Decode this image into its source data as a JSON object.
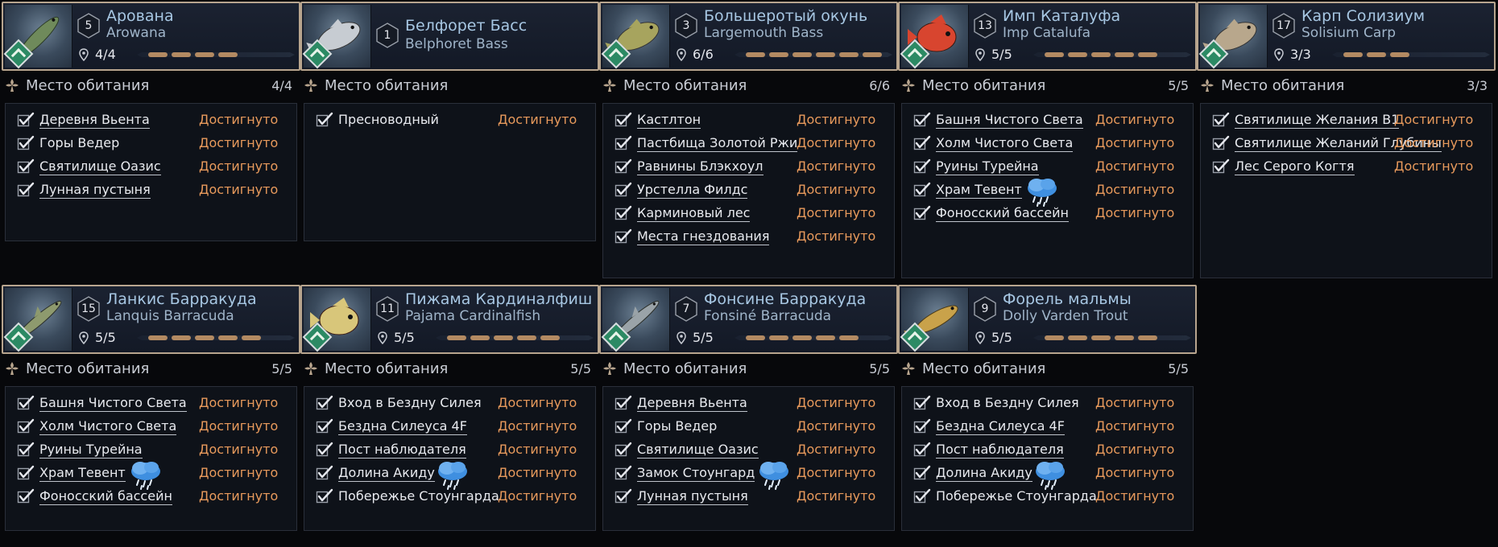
{
  "section_title": "Место обитания",
  "status_label": "Достигнуто",
  "colors": {
    "frame": "#b8a58e",
    "status": "#e89a5c",
    "name": "#a7c7e3",
    "progress": "#b38a62",
    "habitat": "#2c8a64"
  },
  "cards": [
    {
      "id": "arowana",
      "level": "5",
      "name_ru": "Арована",
      "name_en": "Arowana",
      "count": "4/4",
      "progress_segments": 4,
      "fish": "arowana",
      "fish_color": "#6f8a5b",
      "habitat_count": "4/4",
      "locations": [
        {
          "name": "Деревня Вьента",
          "link": true,
          "rain": false
        },
        {
          "name": "Горы Ведер",
          "link": false,
          "rain": false
        },
        {
          "name": "Святилище Оазис",
          "link": true,
          "rain": false
        },
        {
          "name": "Лунная пустыня",
          "link": true,
          "rain": false
        }
      ]
    },
    {
      "id": "belphoret-bass",
      "level": "1",
      "name_ru": "Белфорет Басс",
      "name_en": "Belphoret Bass",
      "count": "",
      "progress_segments": 0,
      "fish": "bass",
      "fish_color": "#c7ccd2",
      "habitat_count": "",
      "locations": [
        {
          "name": "Пресноводный",
          "link": false,
          "rain": false
        }
      ]
    },
    {
      "id": "largemouth-bass",
      "level": "3",
      "name_ru": "Большеротый окунь",
      "name_en": "Largemouth Bass",
      "count": "6/6",
      "progress_segments": 6,
      "fish": "bass",
      "fish_color": "#a7a45e",
      "habitat_count": "6/6",
      "locations": [
        {
          "name": "Кастлтон",
          "link": true,
          "rain": false
        },
        {
          "name": "Пастбища Золотой Ржи",
          "link": true,
          "rain": false
        },
        {
          "name": "Равнины Блэкхоул",
          "link": true,
          "rain": false
        },
        {
          "name": "Урстелла Филдс",
          "link": true,
          "rain": false
        },
        {
          "name": "Карминовый лес",
          "link": true,
          "rain": false
        },
        {
          "name": "Места гнездования",
          "link": true,
          "rain": false
        }
      ]
    },
    {
      "id": "imp-catalufa",
      "level": "13",
      "name_ru": "Имп Каталуфа",
      "name_en": "Imp Catalufa",
      "count": "5/5",
      "progress_segments": 5,
      "fish": "round",
      "fish_color": "#d8452f",
      "habitat_count": "5/5",
      "locations": [
        {
          "name": "Башня Чистого Света",
          "link": true,
          "rain": false
        },
        {
          "name": "Холм Чистого Света",
          "link": true,
          "rain": false
        },
        {
          "name": "Руины Турейна",
          "link": true,
          "rain": false
        },
        {
          "name": "Храм Тевент",
          "link": true,
          "rain": true
        },
        {
          "name": "Фоносский бассейн",
          "link": true,
          "rain": false
        }
      ]
    },
    {
      "id": "solisium-carp",
      "level": "17",
      "name_ru": "Карп Солизиум",
      "name_en": "Solisium Carp",
      "count": "3/3",
      "progress_segments": 3,
      "fish": "bass",
      "fish_color": "#b8a78c",
      "habitat_count": "3/3",
      "locations": [
        {
          "name": "Святилище Желания B1",
          "link": true,
          "rain": false
        },
        {
          "name": "Святилище Желаний Глубины",
          "link": true,
          "rain": false
        },
        {
          "name": "Лес Серого Когтя",
          "link": true,
          "rain": false
        }
      ]
    },
    {
      "id": "lanquis-barracuda",
      "level": "15",
      "name_ru": "Ланкис Барракуда",
      "name_en": "Lanquis Barracuda",
      "count": "5/5",
      "progress_segments": 5,
      "fish": "long",
      "fish_color": "#8e9a6e",
      "habitat_count": "5/5",
      "locations": [
        {
          "name": "Башня Чистого Света",
          "link": true,
          "rain": false
        },
        {
          "name": "Холм Чистого Света",
          "link": true,
          "rain": false
        },
        {
          "name": "Руины Турейна",
          "link": true,
          "rain": false
        },
        {
          "name": "Храм Тевент",
          "link": true,
          "rain": true
        },
        {
          "name": "Фоносский бассейн",
          "link": true,
          "rain": false
        }
      ]
    },
    {
      "id": "pajama-cardinalfish",
      "level": "11",
      "name_ru": "Пижама Кардиналфиш",
      "name_en": "Pajama Cardinalfish",
      "count": "5/5",
      "progress_segments": 5,
      "fish": "round",
      "fish_color": "#d8c67a",
      "habitat_count": "5/5",
      "locations": [
        {
          "name": "Вход в Бездну Силея",
          "link": false,
          "rain": false
        },
        {
          "name": "Бездна Силеуса 4F",
          "link": true,
          "rain": false
        },
        {
          "name": "Пост наблюдателя",
          "link": true,
          "rain": false
        },
        {
          "name": "Долина Акиду",
          "link": true,
          "rain": true
        },
        {
          "name": "Побережье Стоунгарда",
          "link": false,
          "rain": false
        }
      ]
    },
    {
      "id": "fonsine-barracuda",
      "level": "7",
      "name_ru": "Фонсине Барракуда",
      "name_en": "Fonsiné Barracuda",
      "count": "5/5",
      "progress_segments": 5,
      "fish": "long",
      "fish_color": "#9aa3a8",
      "habitat_count": "5/5",
      "locations": [
        {
          "name": "Деревня Вьента",
          "link": true,
          "rain": false
        },
        {
          "name": "Горы Ведер",
          "link": false,
          "rain": false
        },
        {
          "name": "Святилище Оазис",
          "link": true,
          "rain": false
        },
        {
          "name": "Замок Стоунгард",
          "link": true,
          "rain": true
        },
        {
          "name": "Лунная пустыня",
          "link": true,
          "rain": false
        }
      ]
    },
    {
      "id": "dolly-varden-trout",
      "level": "9",
      "name_ru": "Форель мальмы",
      "name_en": "Dolly Varden Trout",
      "count": "5/5",
      "progress_segments": 5,
      "fish": "trout",
      "fish_color": "#c9a24a",
      "habitat_count": "5/5",
      "locations": [
        {
          "name": "Вход в Бездну Силея",
          "link": false,
          "rain": false
        },
        {
          "name": "Бездна Силеуса 4F",
          "link": true,
          "rain": false
        },
        {
          "name": "Пост наблюдателя",
          "link": true,
          "rain": false
        },
        {
          "name": "Долина Акиду",
          "link": true,
          "rain": true
        },
        {
          "name": "Побережье Стоунгарда",
          "link": false,
          "rain": false
        }
      ]
    }
  ]
}
